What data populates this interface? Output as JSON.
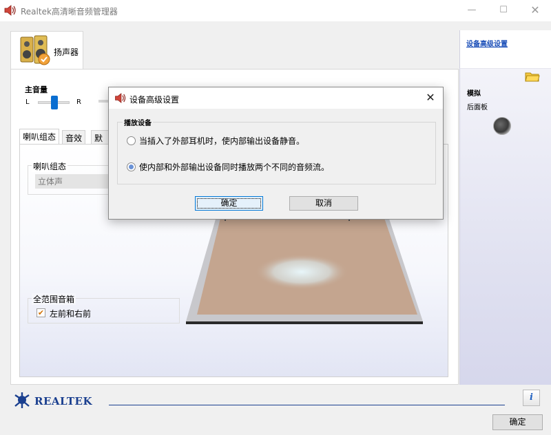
{
  "window": {
    "title": "Realtek高清晰音频管理器",
    "controls": {
      "minimize": "—",
      "maximize": "☐",
      "close": "✕"
    }
  },
  "device_tab": {
    "label": "扬声器"
  },
  "volume": {
    "label": "主音量",
    "left": "L",
    "right": "R"
  },
  "inner_tabs": [
    {
      "label": "喇叭组态"
    },
    {
      "label": "音效"
    },
    {
      "label": "默认"
    }
  ],
  "speaker_config": {
    "group_title": "喇叭组态",
    "selected": "立体声"
  },
  "full_range": {
    "group_title": "全范围音箱",
    "checkbox_label": "左前和右前",
    "checked": true
  },
  "right_panel": {
    "advanced_link": "设备高级设置",
    "analog_label": "模拟",
    "front_panel_label": "后面板"
  },
  "footer": {
    "brand": "REALTEK",
    "info_icon": "i",
    "ok_label": "确定"
  },
  "dialog": {
    "title": "设备高级设置",
    "close": "✕",
    "group_title": "播放设备",
    "options": [
      {
        "label": "当插入了外部耳机时，使内部输出设备静音。",
        "selected": false
      },
      {
        "label": "使内部和外部输出设备同时播放两个不同的音频流。",
        "selected": true
      }
    ],
    "ok_label": "确定",
    "cancel_label": "取消"
  },
  "colors": {
    "accent": "#0a6ed1",
    "link": "#1a4eb8",
    "brand": "#1a3f8f",
    "floor": "#c4a58f"
  }
}
